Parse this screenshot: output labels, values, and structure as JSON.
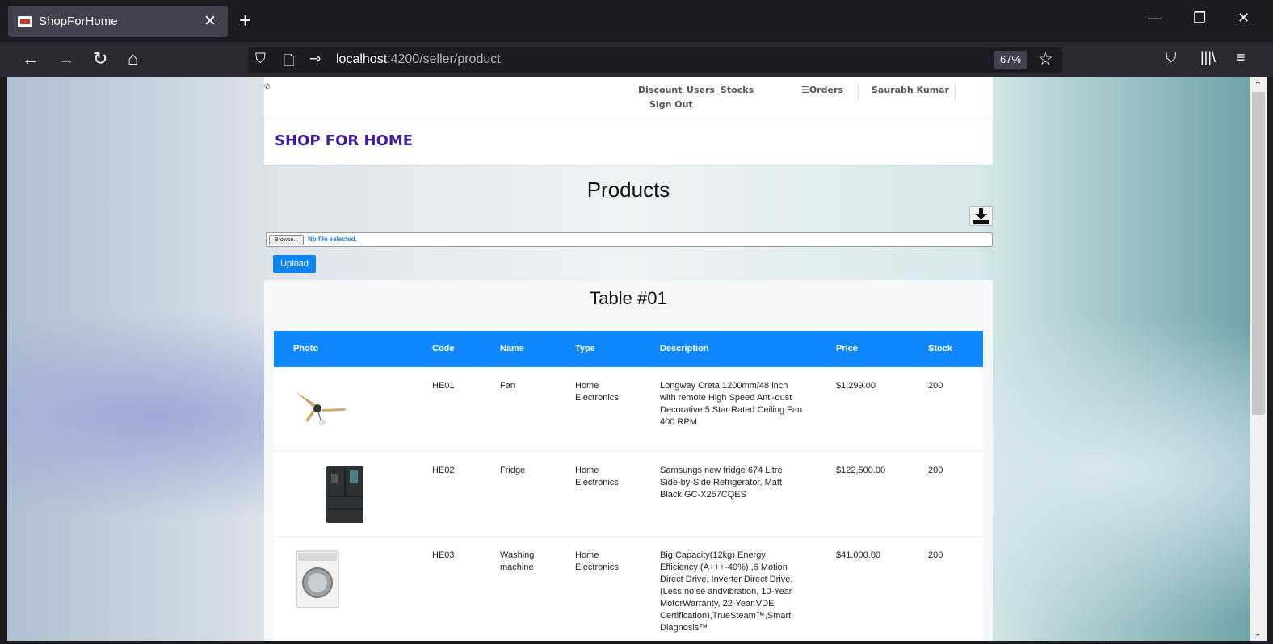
{
  "browser": {
    "tab_title": "ShopForHome",
    "url_host": "localhost",
    "url_path": ":4200/seller/product",
    "zoom": "67%"
  },
  "nav": {
    "discount": "Discount",
    "users": "Users",
    "stocks": "Stocks",
    "orders": "☰Orders",
    "user": "Saurabh Kumar",
    "signout": "Sign Out"
  },
  "brand": "SHOP FOR HOME",
  "products_title": "Products",
  "file": {
    "browse": "Browse...",
    "status": "No file selected."
  },
  "upload_label": "Upload",
  "table": {
    "title": "Table #01",
    "headers": [
      "Photo",
      "Code",
      "Name",
      "Type",
      "Description",
      "Price",
      "Stock"
    ],
    "rows": [
      {
        "photo": "ceiling-fan",
        "code": "HE01",
        "name": "Fan",
        "type": "Home Electronics",
        "description": "Longway Creta 1200mm/48 inch with remote High Speed Anti-dust Decorative 5 Star Rated Ceiling Fan 400 RPM",
        "price": "$1,299.00",
        "stock": "200"
      },
      {
        "photo": "fridge",
        "code": "HE02",
        "name": "Fridge",
        "type": "Home Electronics",
        "description": "Samsungs new fridge 674 Litre Side-by-Side Refrigerator, Matt Black GC-X257CQES",
        "price": "$122,500.00",
        "stock": "200"
      },
      {
        "photo": "washing-machine",
        "code": "HE03",
        "name": "Washing machine",
        "type": "Home Electronics",
        "description": "Big Capacity(12kg) Energy Efficiency (A+++-40%) ,6 Motion Direct Drive, Inverter Direct Drive, (Less noise andvibration, 10-Year MotorWarranty, 22-Year VDE Certification),TrueSteam™,Smart Diagnosis™",
        "price": "$41,000.00",
        "stock": "200"
      }
    ]
  }
}
